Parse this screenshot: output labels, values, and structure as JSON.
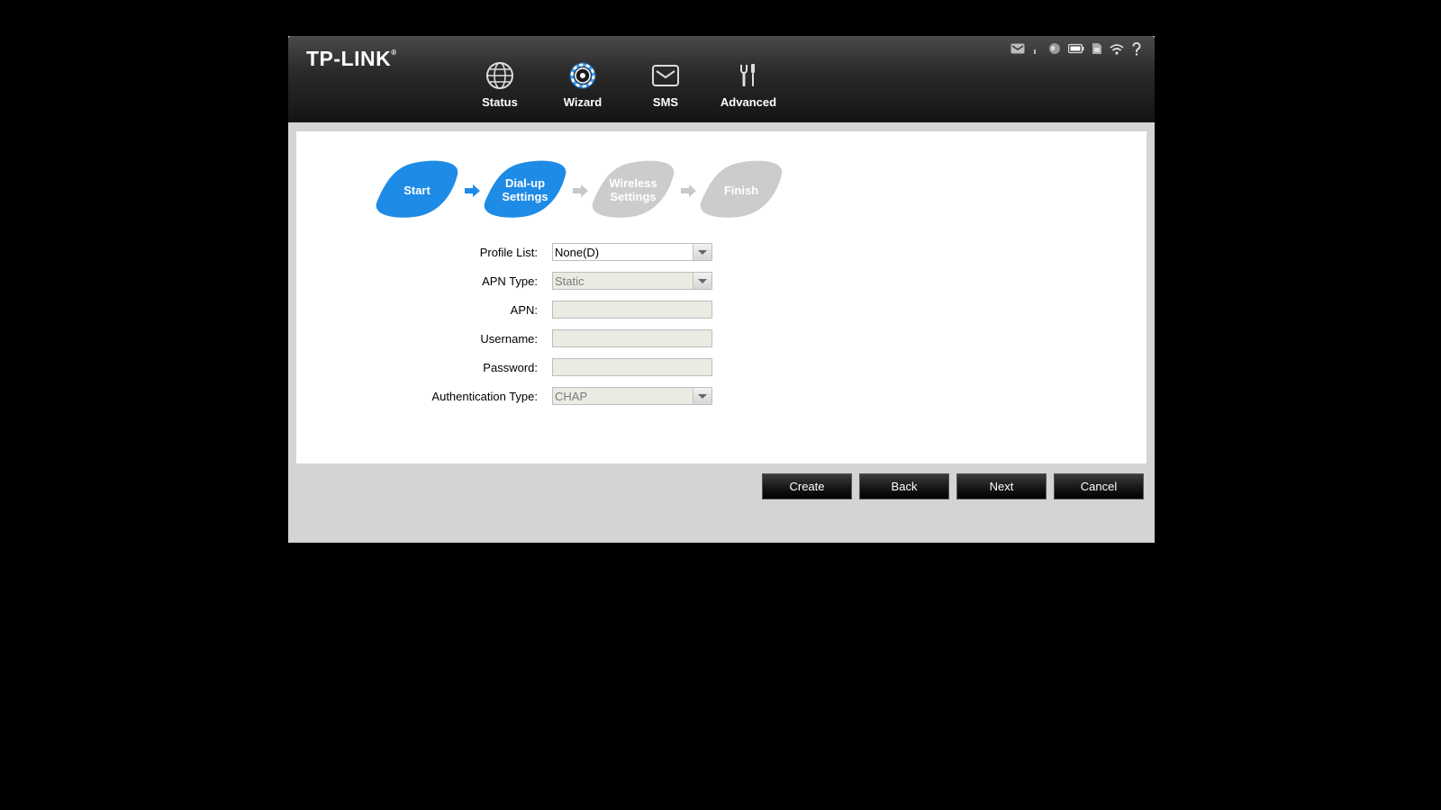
{
  "brand": {
    "logo_text": "TP-LINK",
    "logo_mark": "®"
  },
  "nav": {
    "items": [
      {
        "label": "Status",
        "icon": "globe-icon",
        "active": false
      },
      {
        "label": "Wizard",
        "icon": "wizard-gear-icon",
        "active": true
      },
      {
        "label": "SMS",
        "icon": "envelope-icon",
        "active": false
      },
      {
        "label": "Advanced",
        "icon": "tools-icon",
        "active": false
      }
    ]
  },
  "status_icons": [
    "mail-icon",
    "signal-icon",
    "internet-globe-icon",
    "battery-icon",
    "sim-card-icon",
    "wifi-icon",
    "help-icon"
  ],
  "wizard": {
    "steps": [
      {
        "label": "Start",
        "state": "done"
      },
      {
        "label": "Dial-up\nSettings",
        "state": "active"
      },
      {
        "label": "Wireless\nSettings",
        "state": "pending"
      },
      {
        "label": "Finish",
        "state": "pending"
      }
    ]
  },
  "form": {
    "profile_list": {
      "label": "Profile List:",
      "value": "None(D)"
    },
    "apn_type": {
      "label": "APN Type:",
      "value": "Static"
    },
    "apn": {
      "label": "APN:",
      "value": ""
    },
    "username": {
      "label": "Username:",
      "value": ""
    },
    "password": {
      "label": "Password:",
      "value": ""
    },
    "auth_type": {
      "label": "Authentication Type:",
      "value": "CHAP"
    }
  },
  "buttons": {
    "create": "Create",
    "back": "Back",
    "next": "Next",
    "cancel": "Cancel"
  },
  "colors": {
    "accent": "#1e8be6",
    "pending": "#cccccc",
    "header": "#1c1c1c"
  }
}
